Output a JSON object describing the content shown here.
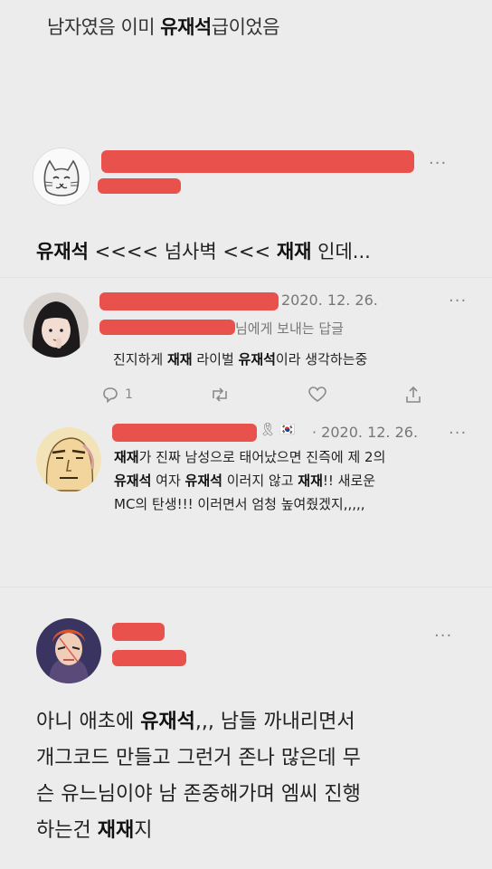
{
  "caption": {
    "pre": "남자였음 이미 ",
    "bold": "유재석",
    "post": "급이었음"
  },
  "tweet1": {
    "text_bold1": "유재석",
    "text_mid": " <<<< 넘사벽 <<< ",
    "text_bold2": "재재",
    "text_post": " 인데...",
    "more_label": "···"
  },
  "reply1": {
    "date": "2020. 12. 26.",
    "reply_to": "님에게 보내는 답글",
    "text_pre": "진지하게 ",
    "text_bold1": "재재",
    "text_mid": " 라이벌 ",
    "text_bold2": "유재석",
    "text_post": "이라 생각하는중",
    "reply_count": "1",
    "more_label": "···"
  },
  "reply2": {
    "date": "· 2020. 12. 26.",
    "flag_glyph": "🎗 🇰🇷",
    "line1_bold": "재재",
    "line1_rest": "가 진짜 남성으로 태어났으면 진즉에 제 2의",
    "line2_bold1": "유재석",
    "line2_mid": " 여자 ",
    "line2_bold2": "유재석",
    "line2_mid2": " 이러지 않고 ",
    "line2_bold3": "재재",
    "line2_post": "!! 새로운",
    "line3": "MC의 탄생!!! 이러면서 엄청 높여줬겠지,,,,,",
    "more_label": "···"
  },
  "tweet4": {
    "l1_pre": "아니 애초에 ",
    "l1_bold": "유재석",
    "l1_post": ",,, 남들 까내리면서",
    "l2": "개그코드 만들고 그런거 존나 많은데 무",
    "l3": "슨 유느님이야 남 존중해가며 엠씨 진행",
    "l4_pre": "하는건 ",
    "l4_bold": "재재",
    "l4_post": "지",
    "more_label": "···"
  },
  "colors": {
    "redaction": "#e8463f",
    "icon_gray": "#8a8a8a"
  }
}
